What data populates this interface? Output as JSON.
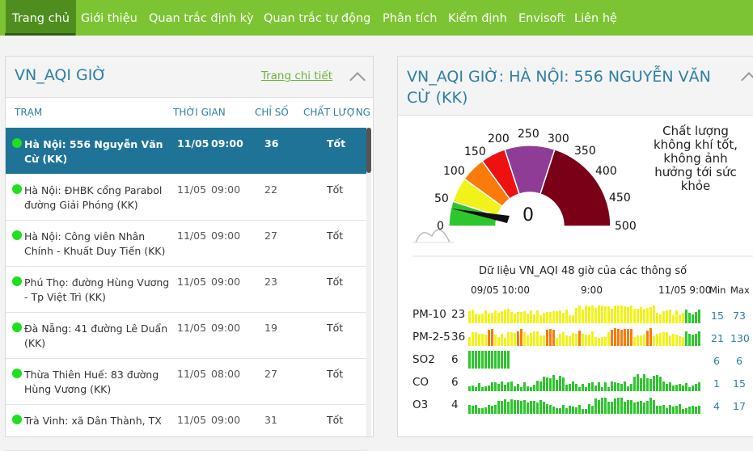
{
  "nav": [
    "Trang chủ",
    "Giới thiệu",
    "Quan trắc định kỳ",
    "Quan trắc tự động",
    "Phân tích",
    "Kiểm định",
    "Envisoft",
    "Liên hệ"
  ],
  "left": {
    "title": "VN_AQI GIỜ",
    "detail_link": "Trang chi tiết",
    "headers": {
      "station": "TRẠM",
      "time": "THỜI GIAN",
      "index": "CHỈ SỐ",
      "quality": "CHẤT LƯỢNG"
    },
    "rows": [
      {
        "station": "Hà Nội: 556 Nguyễn Văn Cừ (KK)",
        "date": "11/05",
        "time": "09:00",
        "index": "36",
        "quality": "Tốt"
      },
      {
        "station": "Hà Nội: ĐHBK cổng Parabol đường Giải Phóng (KK)",
        "date": "11/05",
        "time": "09:00",
        "index": "22",
        "quality": "Tốt"
      },
      {
        "station": "Hà Nội: Công viên Nhân Chính - Khuất Duy Tiến (KK)",
        "date": "11/05",
        "time": "09:00",
        "index": "27",
        "quality": "Tốt"
      },
      {
        "station": "Phú Thọ: đường Hùng Vương - Tp Việt Trì (KK)",
        "date": "11/05",
        "time": "09:00",
        "index": "23",
        "quality": "Tốt"
      },
      {
        "station": "Đà Nẵng: 41 đường Lê Duẩn (KK)",
        "date": "11/05",
        "time": "09:00",
        "index": "19",
        "quality": "Tốt"
      },
      {
        "station": "Thừa Thiên Huế: 83 đường Hùng Vương (KK)",
        "date": "11/05",
        "time": "08:00",
        "index": "27",
        "quality": "Tốt"
      },
      {
        "station": "Trà Vinh: xã Dân Thành, TX",
        "date": "11/05",
        "time": "09:00",
        "index": "31",
        "quality": "Tốt"
      }
    ]
  },
  "right": {
    "title": "VN_AQI GIỜ: HÀ NỘI: 556 NGUYỄN VĂN CỪ (KK)",
    "gauge": {
      "value": 0,
      "value_text": "0",
      "labels": [
        "0",
        "50",
        "100",
        "150",
        "200",
        "250",
        "300",
        "350",
        "400",
        "450",
        "500"
      ],
      "colors": {
        "green": "#2ec62e",
        "yellow": "#f2f21a",
        "orange": "#fa7b0c",
        "red": "#ee1111",
        "purple": "#8e3c96",
        "maroon": "#7a0018"
      }
    },
    "status": "Chất lượng không khí tốt, không ảnh hưởng tới sức khỏe",
    "history": {
      "title": "Dữ liệu VN_AQI 48 giờ của các thông số",
      "axis": [
        "09/05 10:00",
        "9:00",
        "11/05 9:00"
      ],
      "min_label": "Min",
      "max_label": "Max",
      "params": [
        {
          "name": "PM-10",
          "value": "23",
          "min": "15",
          "max": "73"
        },
        {
          "name": "PM-2-5",
          "value": "36",
          "min": "21",
          "max": "130"
        },
        {
          "name": "SO2",
          "value": "6",
          "min": "6",
          "max": "6"
        },
        {
          "name": "CO",
          "value": "6",
          "min": "1",
          "max": "15"
        },
        {
          "name": "O3",
          "value": "4",
          "min": "4",
          "max": "17"
        }
      ]
    }
  }
}
